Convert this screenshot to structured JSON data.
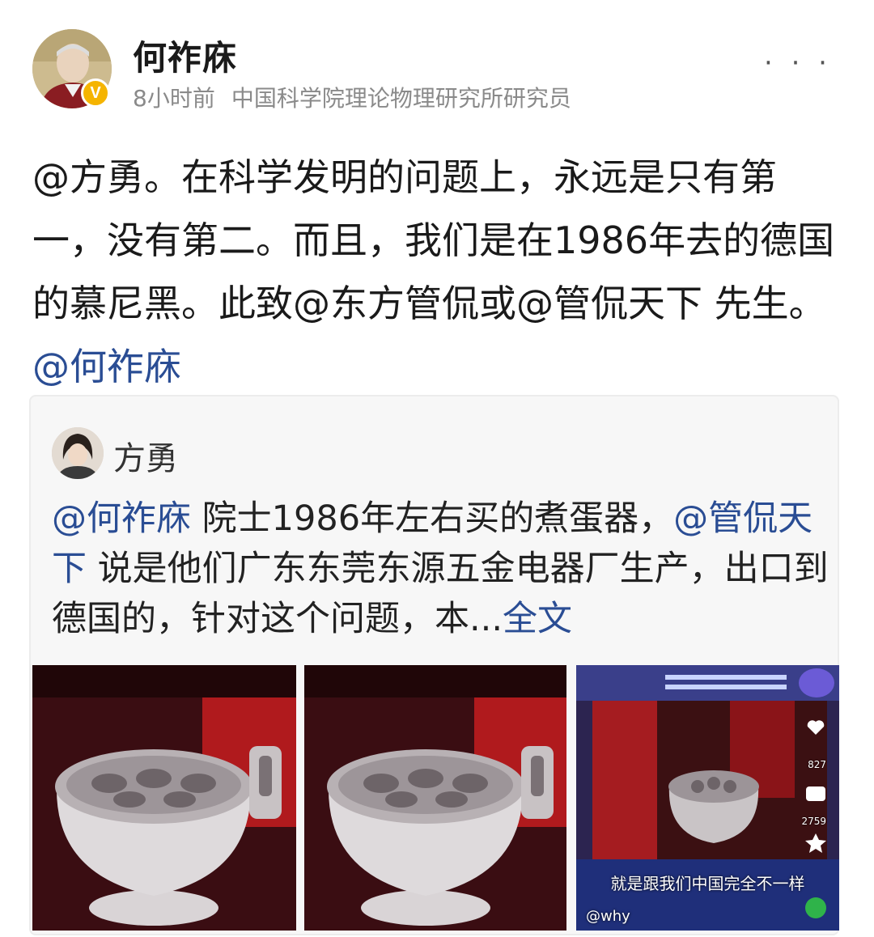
{
  "author": {
    "name": "何祚庥",
    "time": "8小时前",
    "title": "中国科学院理论物理研究所研究员",
    "verified_badge": "V"
  },
  "more_menu": "· · ·",
  "post": {
    "segments": [
      {
        "text": "@方勇",
        "mention": false
      },
      {
        "text": "。在科学发明的问题上，永远是只有第一，没有第二。而且，我们是在1986年去的德国的慕尼黑。此致@东方管侃或@管侃天下 先生。",
        "mention": false
      },
      {
        "text": "@何祚庥",
        "mention": true
      }
    ]
  },
  "quoted": {
    "name": "方勇",
    "segments": [
      {
        "text": "@何祚庥",
        "mention": true
      },
      {
        "text": " 院士1986年左右买的煮蛋器，",
        "mention": false
      },
      {
        "text": "@管侃天下",
        "mention": true
      },
      {
        "text": " 说是他们广东东莞东源五金电器厂生产，出口到德国的，针对这个问题，本...",
        "mention": false
      },
      {
        "text": "全文",
        "mention": true
      }
    ],
    "images": [
      {
        "name": "egg-cooker-photo-1"
      },
      {
        "name": "egg-cooker-photo-2"
      },
      {
        "name": "video-screenshot"
      }
    ],
    "video_overlay": {
      "caption": "就是跟我们中国完全不一样",
      "user": "@why",
      "likes": "827",
      "comments": "2759"
    }
  },
  "colors": {
    "mention": "#2a4d94",
    "meta_gray": "#8a8a8a",
    "badge": "#f5b400"
  }
}
